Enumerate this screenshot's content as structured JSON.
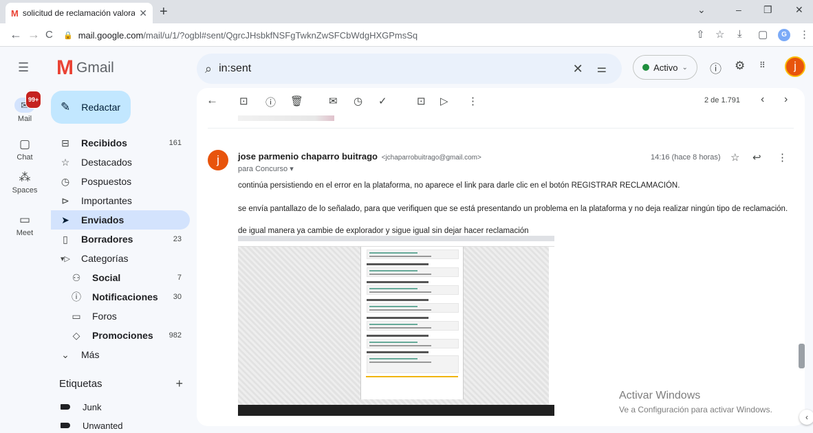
{
  "browser": {
    "tab_title": "solicitud de reclamación valorac",
    "tab_favicon": "M",
    "new_tab": "+",
    "url_host": "mail.google.com",
    "url_path": "/mail/u/1/?ogbl#sent/QgrcJHsbkfNSFgTwknZwSFCbWdgHXGPmsSq",
    "profile_initial": "G",
    "controls": {
      "chevron": "⌄",
      "minimize": "–",
      "restore": "❐",
      "close": "✕"
    },
    "nav": {
      "back": "←",
      "forward": "→",
      "reload": "C"
    },
    "right_icons": {
      "share": "⇧",
      "star": "☆",
      "download": "⤓",
      "sidepanel": "▢",
      "menu": "⋮"
    }
  },
  "gmail": {
    "logo_text": "Gmail",
    "search": {
      "value": "in:sent",
      "clear": "✕",
      "options": "⚌"
    },
    "status": {
      "label": "Activo",
      "color": "#1e8e3e"
    },
    "header_icons": {
      "help": "?",
      "settings": "⚙",
      "apps": "⋮⋮⋮"
    },
    "user_initial": "j"
  },
  "rail": {
    "badge": "99+",
    "items": [
      {
        "label": "Mail",
        "icon": "mail-icon"
      },
      {
        "label": "Chat",
        "icon": "chat-icon"
      },
      {
        "label": "Spaces",
        "icon": "spaces-icon"
      },
      {
        "label": "Meet",
        "icon": "meet-icon"
      }
    ]
  },
  "compose_label": "Redactar",
  "nav": [
    {
      "label": "Recibidos",
      "count": "161",
      "icon": "inbox-icon",
      "bold": true
    },
    {
      "label": "Destacados",
      "count": "",
      "icon": "star-icon",
      "bold": false
    },
    {
      "label": "Pospuestos",
      "count": "",
      "icon": "clock-icon",
      "bold": false
    },
    {
      "label": "Importantes",
      "count": "",
      "icon": "important-icon",
      "bold": false
    },
    {
      "label": "Enviados",
      "count": "",
      "icon": "send-icon",
      "bold": true
    },
    {
      "label": "Borradores",
      "count": "23",
      "icon": "draft-icon",
      "bold": true
    },
    {
      "label": "Categorías",
      "count": "",
      "icon": "category-icon",
      "bold": false
    },
    {
      "label": "Social",
      "count": "7",
      "icon": "social-icon",
      "bold": true
    },
    {
      "label": "Notificaciones",
      "count": "30",
      "icon": "info-icon",
      "bold": true
    },
    {
      "label": "Foros",
      "count": "",
      "icon": "forum-icon",
      "bold": false
    },
    {
      "label": "Promociones",
      "count": "982",
      "icon": "tag-icon",
      "bold": true
    },
    {
      "label": "Más",
      "count": "",
      "icon": "chevron-down-icon",
      "bold": false
    }
  ],
  "labels": {
    "heading": "Etiquetas",
    "add": "+",
    "items": [
      "Junk",
      "Unwanted"
    ]
  },
  "toolbar": {
    "pager": "2 de 1.791"
  },
  "message": {
    "sender_initial": "j",
    "sender_name": "jose parmenio chaparro buitrago",
    "sender_email": "<jchaparrobuitrago@gmail.com>",
    "to": "para Concurso",
    "time": "14:16 (hace 8 horas)",
    "lines": [
      "continúa persistiendo en el error en la plataforma, no aparece el link  para darle clic en el botón REGISTRAR RECLAMACIÓN.",
      "se envía pantallazo de lo señalado, para que verifiquen que se está presentando un problema en la plataforma y no deja realizar ningún tipo de reclamación.",
      "de igual manera ya cambie de explorador  y sigue igual sin dejar hacer reclamación"
    ]
  },
  "watermark": {
    "title": "Activar Windows",
    "subtitle": "Ve a Configuración para activar Windows."
  }
}
